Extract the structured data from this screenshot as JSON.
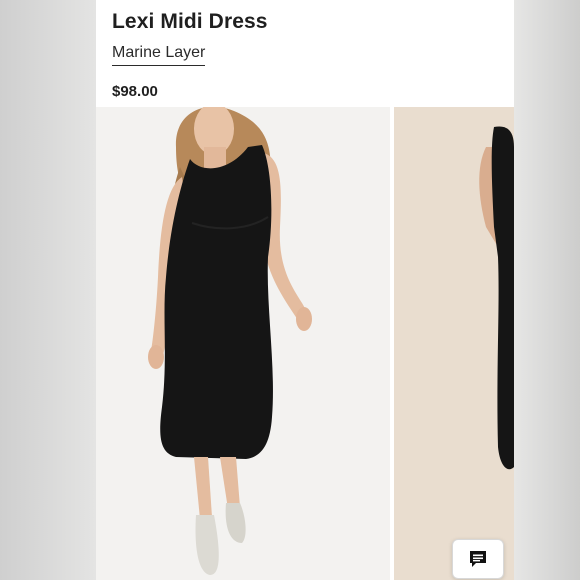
{
  "product": {
    "title": "Lexi Midi Dress",
    "brand": "Marine Layer",
    "price": "$98.00"
  },
  "images": [
    {
      "icon": "product-photo-front",
      "background": "#f2f1ef",
      "dress_color": "#141414"
    },
    {
      "icon": "product-photo-back",
      "background": "#e8dccd",
      "dress_color": "#141414"
    }
  ],
  "chat": {
    "icon": "chat-bubble-icon"
  }
}
